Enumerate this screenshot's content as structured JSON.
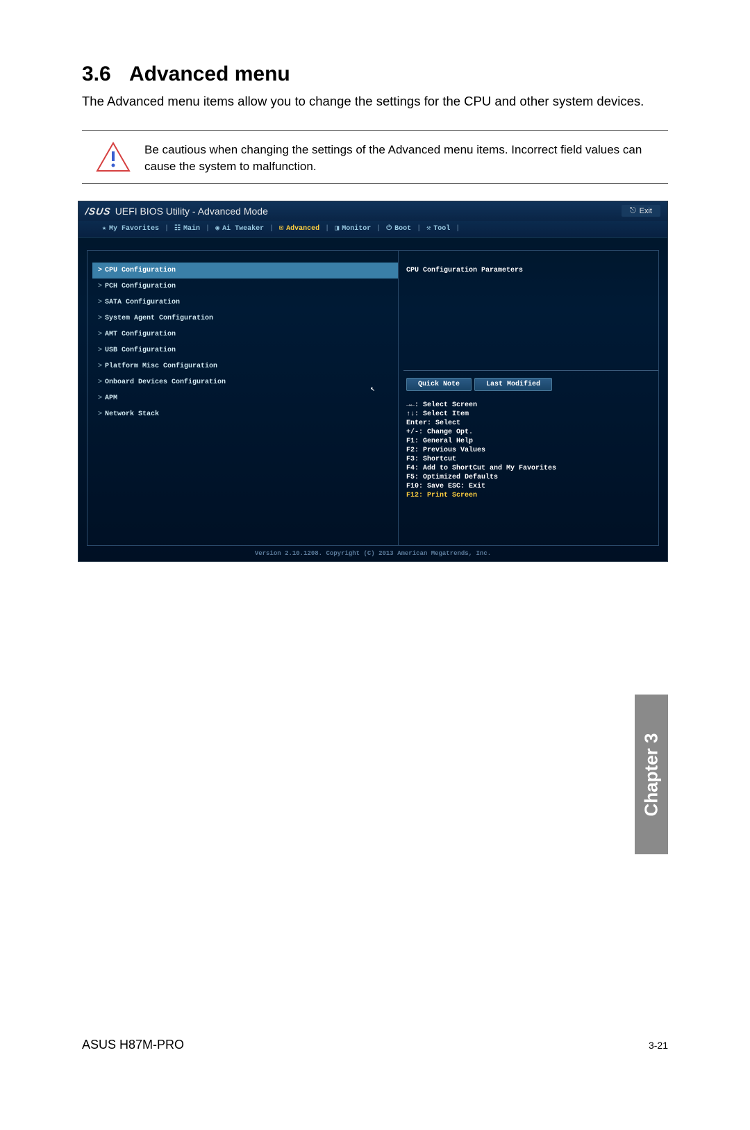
{
  "section_number": "3.6",
  "section_title": "Advanced menu",
  "body_text": "The Advanced menu items allow you to change the settings for the CPU and other system devices.",
  "warning_text": "Be cautious when changing the settings of the Advanced menu items. Incorrect field values can cause the system to malfunction.",
  "bios": {
    "logo_brand": "/SUS",
    "title": "UEFI BIOS Utility - Advanced Mode",
    "exit_label": "Exit",
    "tabs": [
      {
        "icon": "★",
        "label": "My Favorites",
        "active": false
      },
      {
        "icon": "☷",
        "label": "Main",
        "active": false
      },
      {
        "icon": "◉",
        "label": "Ai Tweaker",
        "active": false
      },
      {
        "icon": "⊡",
        "label": "Advanced",
        "active": true
      },
      {
        "icon": "◨",
        "label": "Monitor",
        "active": false
      },
      {
        "icon": "⏻",
        "label": "Boot",
        "active": false
      },
      {
        "icon": "⚒",
        "label": "Tool",
        "active": false
      }
    ],
    "menu_items": [
      {
        "label": "CPU Configuration",
        "selected": true
      },
      {
        "label": "PCH Configuration",
        "selected": false
      },
      {
        "label": "SATA Configuration",
        "selected": false
      },
      {
        "label": "System Agent Configuration",
        "selected": false
      },
      {
        "label": "AMT Configuration",
        "selected": false
      },
      {
        "label": "USB Configuration",
        "selected": false
      },
      {
        "label": "Platform Misc Configuration",
        "selected": false
      },
      {
        "label": "Onboard Devices Configuration",
        "selected": false
      },
      {
        "label": "APM",
        "selected": false
      },
      {
        "label": "Network Stack",
        "selected": false
      }
    ],
    "help_header": "CPU Configuration Parameters",
    "quick_note_label": "Quick Note",
    "last_modified_label": "Last Modified",
    "help_keys": [
      "→←: Select Screen",
      "↑↓: Select Item",
      "Enter: Select",
      "+/-: Change Opt.",
      "F1: General Help",
      "F2: Previous Values",
      "F3: Shortcut",
      "F4: Add to ShortCut and My Favorites",
      "F5: Optimized Defaults",
      "F10: Save  ESC: Exit"
    ],
    "help_key_yellow": "F12: Print Screen",
    "footer": "Version 2.10.1208. Copyright (C) 2013 American Megatrends, Inc."
  },
  "chapter_tab": "Chapter 3",
  "page_footer_left": "ASUS H87M-PRO",
  "page_footer_right": "3-21"
}
